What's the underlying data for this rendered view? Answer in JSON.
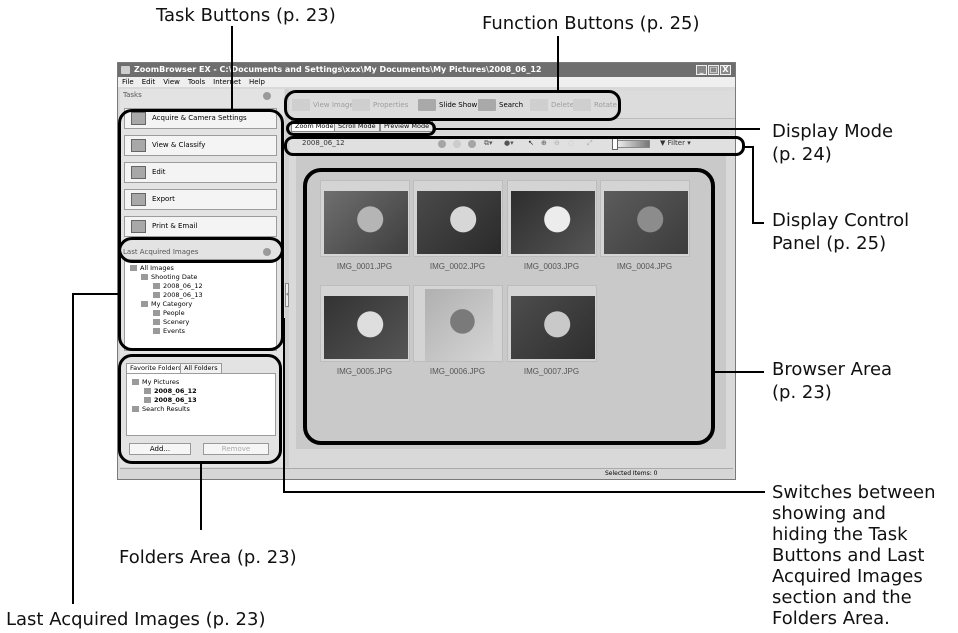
{
  "callouts": {
    "task_buttons": "Task Buttons (p. 23)",
    "function_buttons": "Function Buttons (p. 25)",
    "display_mode_1": "Display Mode",
    "display_mode_2": "(p. 24)",
    "display_control_1": "Display Control",
    "display_control_2": "Panel (p. 25)",
    "browser_area_1": "Browser Area",
    "browser_area_2": "(p. 23)",
    "folders_area": "Folders Area (p. 23)",
    "last_acquired": "Last Acquired Images (p. 23)",
    "switches_1": "Switches between",
    "switches_2": "showing and",
    "switches_3": "hiding the Task",
    "switches_4": "Buttons and Last",
    "switches_5": "Acquired Images",
    "switches_6": "section and the",
    "switches_7": "Folders Area."
  },
  "window": {
    "title": "ZoomBrowser EX  -  C:\\Documents and Settings\\xxx\\My Documents\\My Pictures\\2008_06_12",
    "menu": [
      "File",
      "Edit",
      "View",
      "Tools",
      "Internet",
      "Help"
    ],
    "controls": [
      "_",
      "□",
      "X"
    ]
  },
  "tasks": {
    "title": "Tasks",
    "items": [
      {
        "label": "Acquire & Camera Settings",
        "icon": "camera-icon"
      },
      {
        "label": "View & Classify",
        "icon": "view-icon"
      },
      {
        "label": "Edit",
        "icon": "edit-icon"
      },
      {
        "label": "Export",
        "icon": "export-icon"
      },
      {
        "label": "Print & Email",
        "icon": "print-icon"
      }
    ]
  },
  "last_acquired": {
    "title": "Last Acquired Images",
    "tree": [
      "All Images",
      "Shooting Date",
      "2008_06_12",
      "2008_06_13",
      "My Category",
      "People",
      "Scenery",
      "Events"
    ]
  },
  "folders": {
    "tabs": [
      "Favorite Folders",
      "All Folders"
    ],
    "tree": [
      "My Pictures",
      "2008_06_12",
      "2008_06_13",
      "Search Results"
    ],
    "add_label": "Add...",
    "remove_label": "Remove"
  },
  "function_buttons": [
    {
      "label": "View Image",
      "enabled": false
    },
    {
      "label": "Properties",
      "enabled": false
    },
    {
      "label": "Slide Show",
      "enabled": true
    },
    {
      "label": "Search",
      "enabled": true
    },
    {
      "label": "Delete",
      "enabled": false
    },
    {
      "label": "Rotate",
      "enabled": false
    }
  ],
  "mode_tabs": [
    "Zoom Mode",
    "Scroll Mode",
    "Preview Mode"
  ],
  "control_panel": {
    "folder": "2008_06_12",
    "filter_label": "Filter"
  },
  "thumbnails": [
    {
      "name": "IMG_0001.JPG",
      "colors": [
        "#6f6f6f",
        "#b5b5b5",
        "#3e3e3e"
      ]
    },
    {
      "name": "IMG_0002.JPG",
      "colors": [
        "#4a4a4a",
        "#d7d7d7",
        "#2a2a2a"
      ]
    },
    {
      "name": "IMG_0003.JPG",
      "colors": [
        "#2d2d2d",
        "#ececec",
        "#555555"
      ]
    },
    {
      "name": "IMG_0004.JPG",
      "colors": [
        "#5c5c5c",
        "#8c8c8c",
        "#3c3c3c"
      ]
    },
    {
      "name": "IMG_0005.JPG",
      "colors": [
        "#333333",
        "#dedede",
        "#555555"
      ]
    },
    {
      "name": "IMG_0006.JPG",
      "colors": [
        "#b0b0b0",
        "#7a7a7a",
        "#d5d5d5"
      ]
    },
    {
      "name": "IMG_0007.JPG",
      "colors": [
        "#4d4d4d",
        "#c9c9c9",
        "#2e2e2e"
      ]
    }
  ],
  "status": {
    "selected": "Selected Items: 0"
  }
}
